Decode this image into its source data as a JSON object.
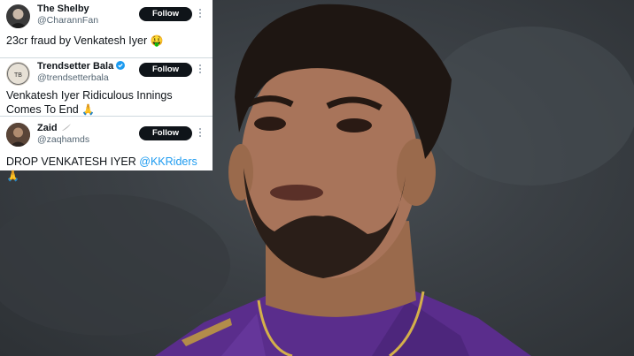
{
  "tweets": [
    {
      "name": "The Shelby",
      "handle": "@CharannFan",
      "follow_label": "Follow",
      "text": "23cr fraud by Venkatesh Iyer",
      "emoji": "🤑",
      "verified": false
    },
    {
      "name": "Trendsetter Bala",
      "handle": "@trendsetterbala",
      "follow_label": "Follow",
      "text": "Venkatesh Iyer Ridiculous Innings Comes To End",
      "emoji": "🙏",
      "verified": true
    },
    {
      "name": "Zaid",
      "handle": "@zaqhamds",
      "follow_label": "Follow",
      "text": "DROP VENKATESH IYER",
      "mention": "@KKRiders",
      "emoji": "🙏",
      "verified": false
    }
  ],
  "colors": {
    "follow_button": "#0f1419",
    "mention": "#1d9bf0",
    "verified": "#1d9bf0",
    "jersey": "#5a2d8c"
  },
  "icons": [
    "verified-badge-icon",
    "feather-icon",
    "more-options-icon"
  ]
}
